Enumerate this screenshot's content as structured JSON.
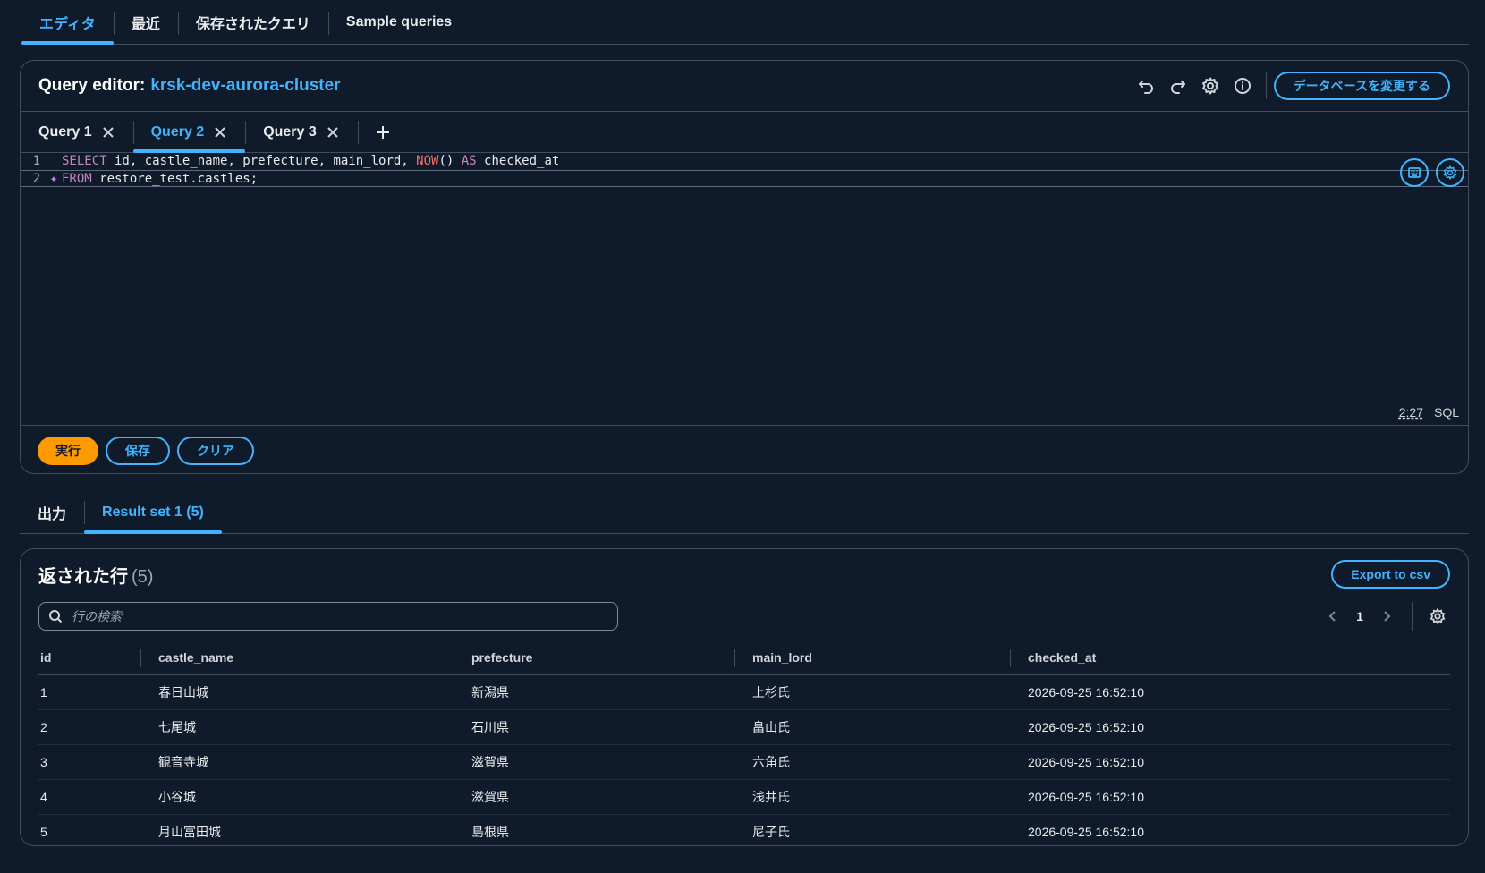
{
  "top_tabs": [
    {
      "label": "エディタ",
      "active": true
    },
    {
      "label": "最近",
      "active": false
    },
    {
      "label": "保存されたクエリ",
      "active": false
    },
    {
      "label": "Sample queries",
      "active": false
    }
  ],
  "editor": {
    "title_prefix": "Query editor:",
    "cluster": "krsk-dev-aurora-cluster",
    "change_db_label": "データベースを変更する",
    "icons": [
      "undo-icon",
      "redo-icon",
      "gear-icon",
      "info-icon"
    ],
    "query_tabs": [
      {
        "label": "Query 1",
        "active": false
      },
      {
        "label": "Query 2",
        "active": true
      },
      {
        "label": "Query 3",
        "active": false
      }
    ],
    "code": {
      "line1_num": "1",
      "line2_num": "2",
      "l1_select": "SELECT",
      "l1_cols": " id, castle_name, prefecture, main_lord, ",
      "l1_now": "NOW",
      "l1_paren": "() ",
      "l1_as": "AS",
      "l1_alias": " checked_at",
      "l2_from": "FROM",
      "l2_rest": " restore_test.castles;"
    },
    "cursor_pos": "2:27",
    "language": "SQL",
    "run_label": "実行",
    "save_label": "保存",
    "clear_label": "クリア"
  },
  "result_tabs": [
    {
      "label": "出力",
      "active": false
    },
    {
      "label": "Result set 1 (5)",
      "active": true
    }
  ],
  "results": {
    "title": "返された行",
    "count": "(5)",
    "export_label": "Export to csv",
    "search_placeholder": "行の検索",
    "page": "1",
    "columns": [
      "id",
      "castle_name",
      "prefecture",
      "main_lord",
      "checked_at"
    ],
    "rows": [
      [
        "1",
        "春日山城",
        "新潟県",
        "上杉氏",
        "2026-09-25 16:52:10"
      ],
      [
        "2",
        "七尾城",
        "石川県",
        "畠山氏",
        "2026-09-25 16:52:10"
      ],
      [
        "3",
        "観音寺城",
        "滋賀県",
        "六角氏",
        "2026-09-25 16:52:10"
      ],
      [
        "4",
        "小谷城",
        "滋賀県",
        "浅井氏",
        "2026-09-25 16:52:10"
      ],
      [
        "5",
        "月山富田城",
        "島根県",
        "尼子氏",
        "2026-09-25 16:52:10"
      ]
    ]
  },
  "colors": {
    "background": "#0f1b2a",
    "accent": "#42b4ff",
    "primary_button": "#ff9900",
    "keyword": "#c586c0",
    "function": "#f87171"
  }
}
